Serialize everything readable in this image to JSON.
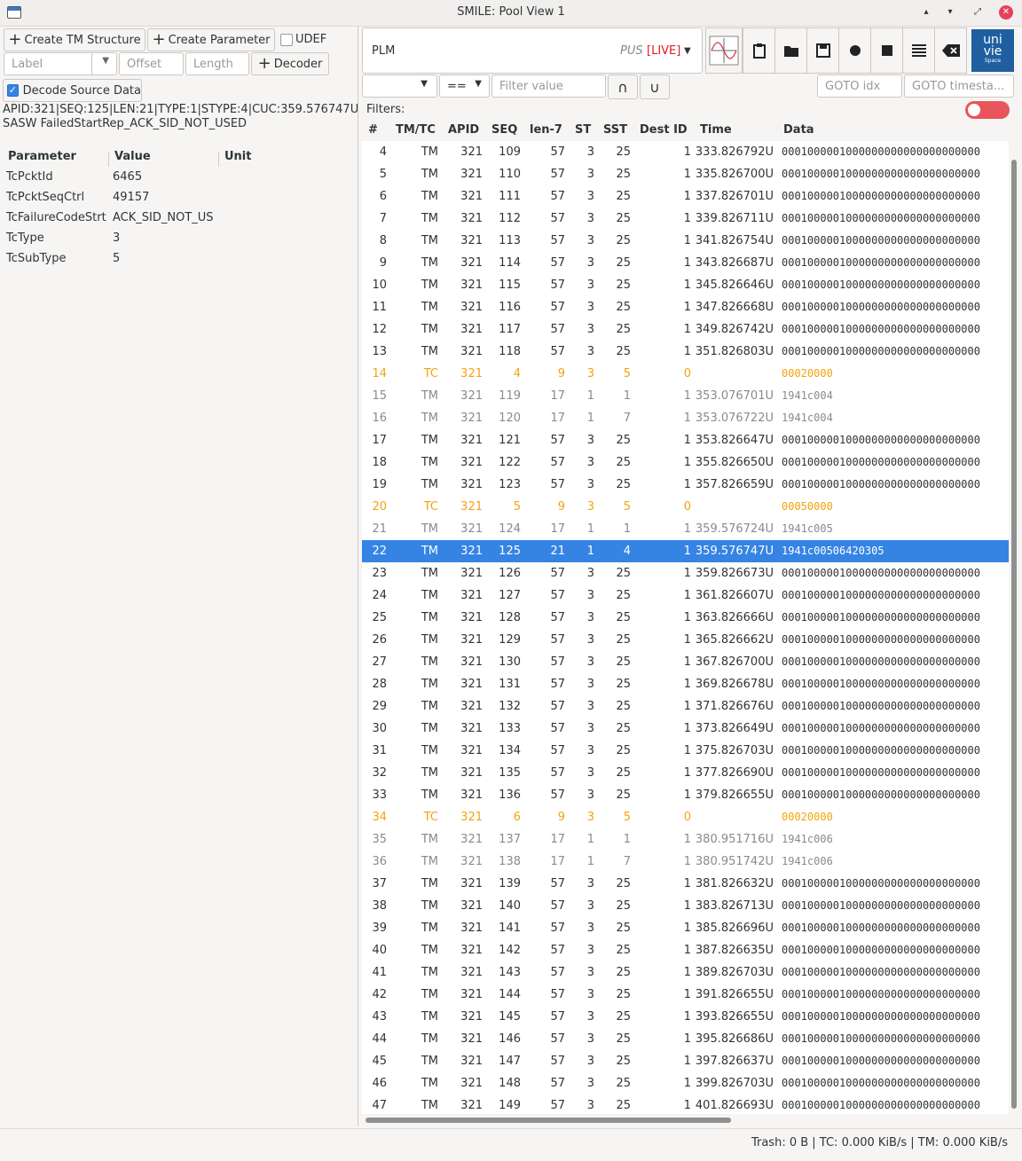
{
  "window": {
    "title": "SMILE: Pool View 1",
    "min": "▴",
    "max": "▾",
    "restore": "⤢",
    "close": "✕"
  },
  "left": {
    "create_tm_structure": "Create TM Structure",
    "create_parameter": "Create Parameter",
    "udef_label": "UDEF",
    "label_placeholder": "Label",
    "offset_placeholder": "Offset",
    "length_placeholder": "Length",
    "decoder_button": "Decoder",
    "decode_source_label": "Decode Source Data",
    "packet_header": "APID:321|SEQ:125|LEN:21|TYPE:1|STYPE:4|CUC:359.576747U",
    "packet_name": "SASW FailedStartRep_ACK_SID_NOT_USED",
    "param_headers": [
      "Parameter",
      "Value",
      "Unit"
    ],
    "params": [
      {
        "name": "TcPcktId",
        "value": "6465"
      },
      {
        "name": "TcPcktSeqCtrl",
        "value": "49157"
      },
      {
        "name": "TcFailureCodeStrt",
        "value": "ACK_SID_NOT_US"
      },
      {
        "name": "TcType",
        "value": "3"
      },
      {
        "name": "TcSubType",
        "value": "5"
      }
    ]
  },
  "right": {
    "pool_name": "PLM",
    "pus_label": "PUS",
    "live_label": "[LIVE]",
    "filter_op": "==",
    "filter_placeholder": "Filter value",
    "and_button": "∩",
    "or_button": "∪",
    "goto_idx_placeholder": "GOTO idx",
    "goto_timestamp_placeholder": "GOTO timesta...",
    "filters_label": "Filters:",
    "logo_text_1": "uni",
    "logo_text_2": "vie",
    "logo_text_3": "Space",
    "columns": [
      "#",
      "TM/TC",
      "APID",
      "SEQ",
      "len-7",
      "ST",
      "SST",
      "Dest ID",
      "Time",
      "Data"
    ],
    "rows": [
      {
        "n": "4",
        "k": "TM",
        "apid": "321",
        "seq": "109",
        "len": "57",
        "st": "3",
        "sst": "25",
        "dest": "1",
        "time": "333.826792U",
        "data": "0001000001000000000000000000000",
        "style": "tm"
      },
      {
        "n": "5",
        "k": "TM",
        "apid": "321",
        "seq": "110",
        "len": "57",
        "st": "3",
        "sst": "25",
        "dest": "1",
        "time": "335.826700U",
        "data": "0001000001000000000000000000000",
        "style": "tm"
      },
      {
        "n": "6",
        "k": "TM",
        "apid": "321",
        "seq": "111",
        "len": "57",
        "st": "3",
        "sst": "25",
        "dest": "1",
        "time": "337.826701U",
        "data": "0001000001000000000000000000000",
        "style": "tm"
      },
      {
        "n": "7",
        "k": "TM",
        "apid": "321",
        "seq": "112",
        "len": "57",
        "st": "3",
        "sst": "25",
        "dest": "1",
        "time": "339.826711U",
        "data": "0001000001000000000000000000000",
        "style": "tm"
      },
      {
        "n": "8",
        "k": "TM",
        "apid": "321",
        "seq": "113",
        "len": "57",
        "st": "3",
        "sst": "25",
        "dest": "1",
        "time": "341.826754U",
        "data": "0001000001000000000000000000000",
        "style": "tm"
      },
      {
        "n": "9",
        "k": "TM",
        "apid": "321",
        "seq": "114",
        "len": "57",
        "st": "3",
        "sst": "25",
        "dest": "1",
        "time": "343.826687U",
        "data": "0001000001000000000000000000000",
        "style": "tm"
      },
      {
        "n": "10",
        "k": "TM",
        "apid": "321",
        "seq": "115",
        "len": "57",
        "st": "3",
        "sst": "25",
        "dest": "1",
        "time": "345.826646U",
        "data": "0001000001000000000000000000000",
        "style": "tm"
      },
      {
        "n": "11",
        "k": "TM",
        "apid": "321",
        "seq": "116",
        "len": "57",
        "st": "3",
        "sst": "25",
        "dest": "1",
        "time": "347.826668U",
        "data": "0001000001000000000000000000000",
        "style": "tm"
      },
      {
        "n": "12",
        "k": "TM",
        "apid": "321",
        "seq": "117",
        "len": "57",
        "st": "3",
        "sst": "25",
        "dest": "1",
        "time": "349.826742U",
        "data": "0001000001000000000000000000000",
        "style": "tm"
      },
      {
        "n": "13",
        "k": "TM",
        "apid": "321",
        "seq": "118",
        "len": "57",
        "st": "3",
        "sst": "25",
        "dest": "1",
        "time": "351.826803U",
        "data": "0001000001000000000000000000000",
        "style": "tm"
      },
      {
        "n": "14",
        "k": "TC",
        "apid": "321",
        "seq": "4",
        "len": "9",
        "st": "3",
        "sst": "5",
        "dest": "0",
        "time": "",
        "data": "00020000",
        "style": "tc"
      },
      {
        "n": "15",
        "k": "TM",
        "apid": "321",
        "seq": "119",
        "len": "17",
        "st": "1",
        "sst": "1",
        "dest": "1",
        "time": "353.076701U",
        "data": "1941c004",
        "style": "dim"
      },
      {
        "n": "16",
        "k": "TM",
        "apid": "321",
        "seq": "120",
        "len": "17",
        "st": "1",
        "sst": "7",
        "dest": "1",
        "time": "353.076722U",
        "data": "1941c004",
        "style": "dim"
      },
      {
        "n": "17",
        "k": "TM",
        "apid": "321",
        "seq": "121",
        "len": "57",
        "st": "3",
        "sst": "25",
        "dest": "1",
        "time": "353.826647U",
        "data": "0001000001000000000000000000000",
        "style": "tm"
      },
      {
        "n": "18",
        "k": "TM",
        "apid": "321",
        "seq": "122",
        "len": "57",
        "st": "3",
        "sst": "25",
        "dest": "1",
        "time": "355.826650U",
        "data": "0001000001000000000000000000000",
        "style": "tm"
      },
      {
        "n": "19",
        "k": "TM",
        "apid": "321",
        "seq": "123",
        "len": "57",
        "st": "3",
        "sst": "25",
        "dest": "1",
        "time": "357.826659U",
        "data": "0001000001000000000000000000000",
        "style": "tm"
      },
      {
        "n": "20",
        "k": "TC",
        "apid": "321",
        "seq": "5",
        "len": "9",
        "st": "3",
        "sst": "5",
        "dest": "0",
        "time": "",
        "data": "00050000",
        "style": "tc"
      },
      {
        "n": "21",
        "k": "TM",
        "apid": "321",
        "seq": "124",
        "len": "17",
        "st": "1",
        "sst": "1",
        "dest": "1",
        "time": "359.576724U",
        "data": "1941c005",
        "style": "dim"
      },
      {
        "n": "22",
        "k": "TM",
        "apid": "321",
        "seq": "125",
        "len": "21",
        "st": "1",
        "sst": "4",
        "dest": "1",
        "time": "359.576747U",
        "data": "1941c00506420305",
        "style": "sel"
      },
      {
        "n": "23",
        "k": "TM",
        "apid": "321",
        "seq": "126",
        "len": "57",
        "st": "3",
        "sst": "25",
        "dest": "1",
        "time": "359.826673U",
        "data": "0001000001000000000000000000000",
        "style": "tm"
      },
      {
        "n": "24",
        "k": "TM",
        "apid": "321",
        "seq": "127",
        "len": "57",
        "st": "3",
        "sst": "25",
        "dest": "1",
        "time": "361.826607U",
        "data": "0001000001000000000000000000000",
        "style": "tm"
      },
      {
        "n": "25",
        "k": "TM",
        "apid": "321",
        "seq": "128",
        "len": "57",
        "st": "3",
        "sst": "25",
        "dest": "1",
        "time": "363.826666U",
        "data": "0001000001000000000000000000000",
        "style": "tm"
      },
      {
        "n": "26",
        "k": "TM",
        "apid": "321",
        "seq": "129",
        "len": "57",
        "st": "3",
        "sst": "25",
        "dest": "1",
        "time": "365.826662U",
        "data": "0001000001000000000000000000000",
        "style": "tm"
      },
      {
        "n": "27",
        "k": "TM",
        "apid": "321",
        "seq": "130",
        "len": "57",
        "st": "3",
        "sst": "25",
        "dest": "1",
        "time": "367.826700U",
        "data": "0001000001000000000000000000000",
        "style": "tm"
      },
      {
        "n": "28",
        "k": "TM",
        "apid": "321",
        "seq": "131",
        "len": "57",
        "st": "3",
        "sst": "25",
        "dest": "1",
        "time": "369.826678U",
        "data": "0001000001000000000000000000000",
        "style": "tm"
      },
      {
        "n": "29",
        "k": "TM",
        "apid": "321",
        "seq": "132",
        "len": "57",
        "st": "3",
        "sst": "25",
        "dest": "1",
        "time": "371.826676U",
        "data": "0001000001000000000000000000000",
        "style": "tm"
      },
      {
        "n": "30",
        "k": "TM",
        "apid": "321",
        "seq": "133",
        "len": "57",
        "st": "3",
        "sst": "25",
        "dest": "1",
        "time": "373.826649U",
        "data": "0001000001000000000000000000000",
        "style": "tm"
      },
      {
        "n": "31",
        "k": "TM",
        "apid": "321",
        "seq": "134",
        "len": "57",
        "st": "3",
        "sst": "25",
        "dest": "1",
        "time": "375.826703U",
        "data": "0001000001000000000000000000000",
        "style": "tm"
      },
      {
        "n": "32",
        "k": "TM",
        "apid": "321",
        "seq": "135",
        "len": "57",
        "st": "3",
        "sst": "25",
        "dest": "1",
        "time": "377.826690U",
        "data": "0001000001000000000000000000000",
        "style": "tm"
      },
      {
        "n": "33",
        "k": "TM",
        "apid": "321",
        "seq": "136",
        "len": "57",
        "st": "3",
        "sst": "25",
        "dest": "1",
        "time": "379.826655U",
        "data": "0001000001000000000000000000000",
        "style": "tm"
      },
      {
        "n": "34",
        "k": "TC",
        "apid": "321",
        "seq": "6",
        "len": "9",
        "st": "3",
        "sst": "5",
        "dest": "0",
        "time": "",
        "data": "00020000",
        "style": "tc"
      },
      {
        "n": "35",
        "k": "TM",
        "apid": "321",
        "seq": "137",
        "len": "17",
        "st": "1",
        "sst": "1",
        "dest": "1",
        "time": "380.951716U",
        "data": "1941c006",
        "style": "dim"
      },
      {
        "n": "36",
        "k": "TM",
        "apid": "321",
        "seq": "138",
        "len": "17",
        "st": "1",
        "sst": "7",
        "dest": "1",
        "time": "380.951742U",
        "data": "1941c006",
        "style": "dim"
      },
      {
        "n": "37",
        "k": "TM",
        "apid": "321",
        "seq": "139",
        "len": "57",
        "st": "3",
        "sst": "25",
        "dest": "1",
        "time": "381.826632U",
        "data": "0001000001000000000000000000000",
        "style": "tm"
      },
      {
        "n": "38",
        "k": "TM",
        "apid": "321",
        "seq": "140",
        "len": "57",
        "st": "3",
        "sst": "25",
        "dest": "1",
        "time": "383.826713U",
        "data": "0001000001000000000000000000000",
        "style": "tm"
      },
      {
        "n": "39",
        "k": "TM",
        "apid": "321",
        "seq": "141",
        "len": "57",
        "st": "3",
        "sst": "25",
        "dest": "1",
        "time": "385.826696U",
        "data": "0001000001000000000000000000000",
        "style": "tm"
      },
      {
        "n": "40",
        "k": "TM",
        "apid": "321",
        "seq": "142",
        "len": "57",
        "st": "3",
        "sst": "25",
        "dest": "1",
        "time": "387.826635U",
        "data": "0001000001000000000000000000000",
        "style": "tm"
      },
      {
        "n": "41",
        "k": "TM",
        "apid": "321",
        "seq": "143",
        "len": "57",
        "st": "3",
        "sst": "25",
        "dest": "1",
        "time": "389.826703U",
        "data": "0001000001000000000000000000000",
        "style": "tm"
      },
      {
        "n": "42",
        "k": "TM",
        "apid": "321",
        "seq": "144",
        "len": "57",
        "st": "3",
        "sst": "25",
        "dest": "1",
        "time": "391.826655U",
        "data": "0001000001000000000000000000000",
        "style": "tm"
      },
      {
        "n": "43",
        "k": "TM",
        "apid": "321",
        "seq": "145",
        "len": "57",
        "st": "3",
        "sst": "25",
        "dest": "1",
        "time": "393.826655U",
        "data": "0001000001000000000000000000000",
        "style": "tm"
      },
      {
        "n": "44",
        "k": "TM",
        "apid": "321",
        "seq": "146",
        "len": "57",
        "st": "3",
        "sst": "25",
        "dest": "1",
        "time": "395.826686U",
        "data": "0001000001000000000000000000000",
        "style": "tm"
      },
      {
        "n": "45",
        "k": "TM",
        "apid": "321",
        "seq": "147",
        "len": "57",
        "st": "3",
        "sst": "25",
        "dest": "1",
        "time": "397.826637U",
        "data": "0001000001000000000000000000000",
        "style": "tm"
      },
      {
        "n": "46",
        "k": "TM",
        "apid": "321",
        "seq": "148",
        "len": "57",
        "st": "3",
        "sst": "25",
        "dest": "1",
        "time": "399.826703U",
        "data": "0001000001000000000000000000000",
        "style": "tm"
      },
      {
        "n": "47",
        "k": "TM",
        "apid": "321",
        "seq": "149",
        "len": "57",
        "st": "3",
        "sst": "25",
        "dest": "1",
        "time": "401.826693U",
        "data": "0001000001000000000000000000000",
        "style": "tm"
      }
    ]
  },
  "status": {
    "text": "Trash: 0 B | TC:  0.000 KiB/s | TM:  0.000 KiB/s"
  },
  "colors": {
    "selection": "#3584e4",
    "tc_row": "#f2a30f",
    "live": "#e01b24",
    "toggle_off": "#e8555a"
  }
}
